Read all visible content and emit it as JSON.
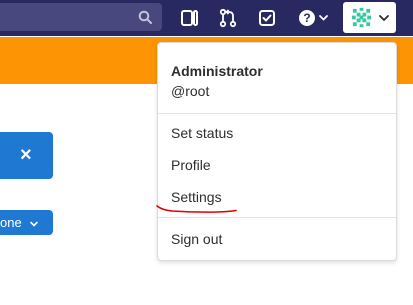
{
  "topbar": {
    "background": "#292961",
    "search_icon": "search-icon",
    "icons": [
      "issues-icon",
      "merge-request-icon",
      "todo-icon",
      "help-icon"
    ],
    "avatar_icon": "identicon-avatar",
    "caret_icon": "chevron-down-icon"
  },
  "banner": {
    "color": "#fc9403"
  },
  "left_controls": {
    "close_label": "×",
    "pill_label": "one"
  },
  "user_menu": {
    "name": "Administrator",
    "username": "@root",
    "items": [
      {
        "label": "Set status"
      },
      {
        "label": "Profile"
      },
      {
        "label": "Settings"
      },
      {
        "label": "Sign out"
      }
    ]
  },
  "annotation": {
    "color": "#e00000",
    "target": "Settings"
  }
}
